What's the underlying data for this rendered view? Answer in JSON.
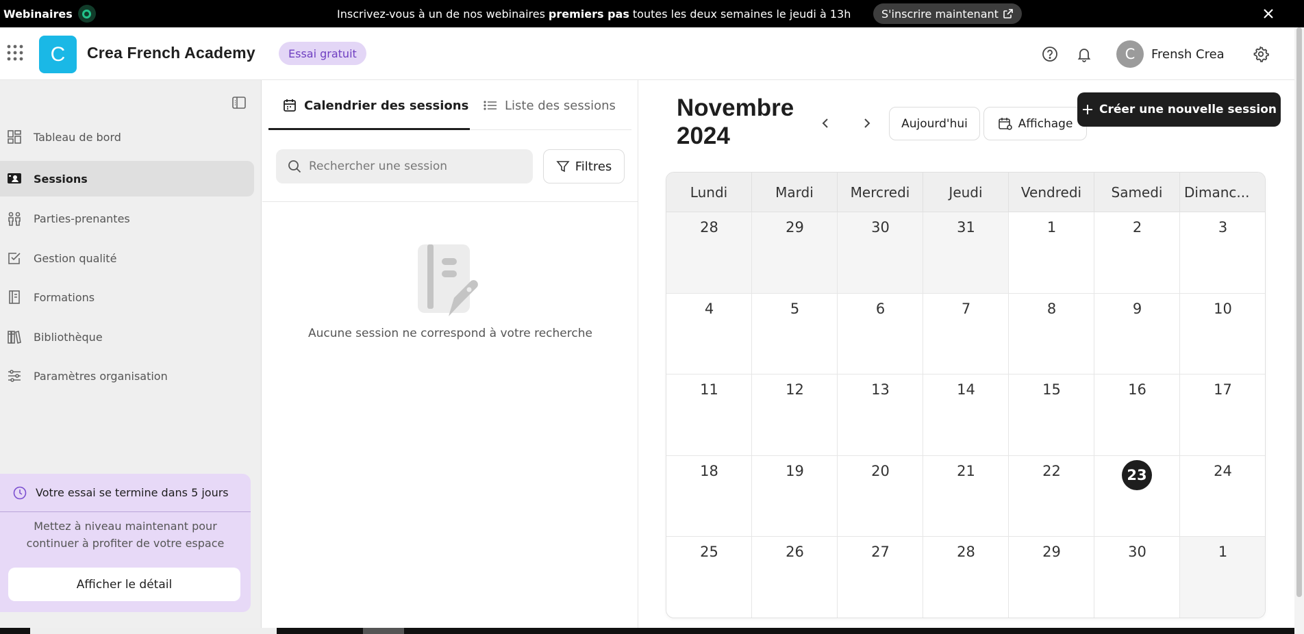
{
  "banner": {
    "brand": "Webinaires",
    "message_before": "Inscrivez-vous à un de nos webinaires",
    "message_bold": "premiers pas",
    "message_after": "toutes les deux semaines le jeudi à 13h",
    "cta_label": "S'inscrire maintenant"
  },
  "header": {
    "org_initial": "C",
    "org_name": "Crea French Academy",
    "trial_badge": "Essai gratuit",
    "user_initial": "C",
    "user_name": "Frensh Crea"
  },
  "sidebar": {
    "items": [
      {
        "label": "Tableau de bord",
        "icon": "dashboard-icon",
        "active": false
      },
      {
        "label": "Sessions",
        "icon": "sessions-icon",
        "active": true
      },
      {
        "label": "Parties-prenantes",
        "icon": "stakeholders-icon",
        "active": false
      },
      {
        "label": "Gestion qualité",
        "icon": "quality-check-icon",
        "active": false
      },
      {
        "label": "Formations",
        "icon": "formations-icon",
        "active": false
      },
      {
        "label": "Bibliothèque",
        "icon": "library-icon",
        "active": false
      },
      {
        "label": "Paramètres organisation",
        "icon": "settings-sliders-icon",
        "active": false
      }
    ],
    "trial_card": {
      "title": "Votre essai se termine dans 5 jours",
      "line1": "Mettez à niveau maintenant pour",
      "line2": "continuer à profiter de votre espace",
      "button": "Afficher le détail"
    }
  },
  "sessions": {
    "tabs": [
      {
        "label": "Calendrier des sessions",
        "icon": "calendar-icon",
        "active": true
      },
      {
        "label": "Liste des sessions",
        "icon": "list-icon",
        "active": false
      }
    ],
    "search_placeholder": "Rechercher une session",
    "filters_label": "Filtres",
    "empty_message": "Aucune session ne correspond à votre recherche"
  },
  "calendar": {
    "month_line1": "Novembre",
    "month_line2": "2024",
    "today_label": "Aujourd'hui",
    "view_label": "Affichage",
    "create_label": "Créer une nouvelle session",
    "weekdays": [
      "Lundi",
      "Mardi",
      "Mercredi",
      "Jeudi",
      "Vendredi",
      "Samedi",
      "Dimanc..."
    ],
    "days": [
      {
        "n": "28",
        "outside": true
      },
      {
        "n": "29",
        "outside": true
      },
      {
        "n": "30",
        "outside": true
      },
      {
        "n": "31",
        "outside": true
      },
      {
        "n": "1"
      },
      {
        "n": "2"
      },
      {
        "n": "3"
      },
      {
        "n": "4"
      },
      {
        "n": "5"
      },
      {
        "n": "6"
      },
      {
        "n": "7"
      },
      {
        "n": "8"
      },
      {
        "n": "9"
      },
      {
        "n": "10"
      },
      {
        "n": "11"
      },
      {
        "n": "12"
      },
      {
        "n": "13"
      },
      {
        "n": "14"
      },
      {
        "n": "15"
      },
      {
        "n": "16"
      },
      {
        "n": "17"
      },
      {
        "n": "18"
      },
      {
        "n": "19"
      },
      {
        "n": "20"
      },
      {
        "n": "21"
      },
      {
        "n": "22"
      },
      {
        "n": "23",
        "today": true
      },
      {
        "n": "24"
      },
      {
        "n": "25"
      },
      {
        "n": "26"
      },
      {
        "n": "27"
      },
      {
        "n": "28"
      },
      {
        "n": "29"
      },
      {
        "n": "30"
      },
      {
        "n": "1",
        "outside": true
      }
    ]
  },
  "colors": {
    "accent_cyan": "#1ab8e6",
    "trial_purple_bg": "#e7d9f7",
    "trial_purple_text": "#6f3fc1",
    "live_green": "#22c38b",
    "primary_dark": "#1e1e1e"
  }
}
